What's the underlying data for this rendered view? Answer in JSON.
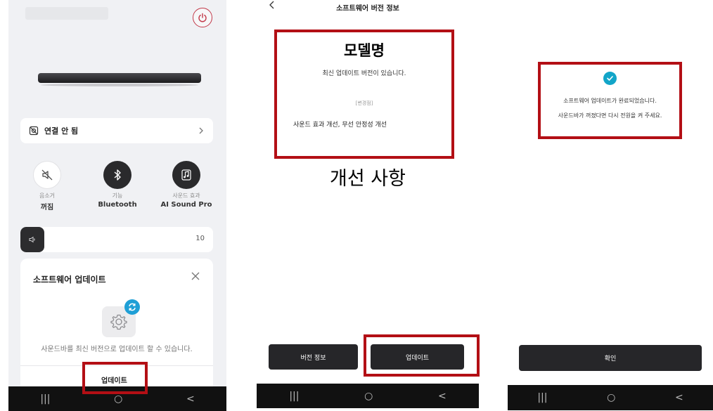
{
  "panel1": {
    "connection": {
      "label": "연결 안 됨",
      "icon": "disconnected-icon"
    },
    "quick_actions": [
      {
        "caption": "음소거",
        "value": "꺼짐",
        "icon": "mute-icon"
      },
      {
        "caption": "기능",
        "value": "Bluetooth",
        "icon": "bluetooth-icon"
      },
      {
        "caption": "사운드 효과",
        "value": "AI Sound Pro",
        "icon": "music-note-icon"
      }
    ],
    "volume": {
      "value": "10",
      "level": 10
    },
    "software_update": {
      "title": "소프트웨어 업데이트",
      "description": "사운드바를 최신 버전으로 업데이트 할 수 있습니다.",
      "button": "업데이트"
    },
    "colors": {
      "background": "#f0f1f4",
      "power": "#c23a4a",
      "badge": "#1f9fd6"
    }
  },
  "panel2": {
    "title": "소프트웨어 버전 정보",
    "model_name": "모델명",
    "latest_message": "최신 업데이트 버전이 있습니다.",
    "change_tag": "[변경점]",
    "change_text": "사운드 효과 개선, 무선 안정성 개선",
    "caption": "개선 사항",
    "buttons": {
      "version_info": "버전 정보",
      "update": "업데이트"
    }
  },
  "panel3": {
    "message_1": "소프트웨어 업데이트가 완료되었습니다.",
    "message_2": "사운드바가 꺼졌다면 다시 전원을 켜 주세요.",
    "button": "확인",
    "colors": {
      "check": "#12a5c8"
    }
  },
  "nav": {
    "recent": "|||",
    "home": "○",
    "back": "<"
  },
  "highlight_color": "#b30f15"
}
